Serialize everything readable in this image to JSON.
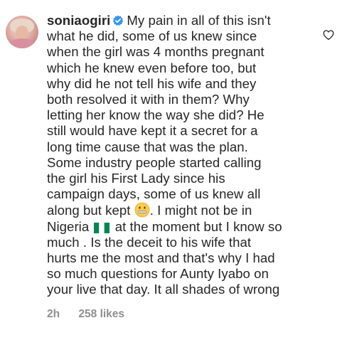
{
  "comment": {
    "username": "soniaogiri",
    "lines": [
      "My pain in all of this isn't",
      "what he did, some of us knew since",
      "when the girl was 4 months pregnant",
      "which he knew even before too, but",
      "why did he not tell his wife and they",
      "both resolved it with in them? Why",
      "letting her know the way she did? He",
      "still would have kept it a secret for a",
      "long time cause that was the plan.",
      "Some industry people started calling",
      "the girl his First Lady since his",
      "campaign days, some of us knew all"
    ],
    "line13_before_emoji": "along but kept ",
    "line13_after_emoji": ". I might not be in",
    "line14_before_flag": "Nigeria ",
    "line14_after_flag": " at the moment but I know so",
    "lines_after": [
      "much .  Is the deceit to his wife that",
      "hurts me the most and that's why I had",
      "so much questions for Aunty Iyabo on",
      "your live that day. It all shades of wrong"
    ],
    "emoji_name": "zipper-mouth-face",
    "flag_name": "nigeria-flag"
  },
  "meta": {
    "time": "2h",
    "likes": "258 likes"
  },
  "colors": {
    "text": "#262626",
    "meta": "#8e8e8e",
    "verified": "#3897f0",
    "flag_green": "#008751"
  },
  "icons": {
    "heart": "heart-outline-icon",
    "verified": "verified-badge-icon",
    "avatar": "profile-avatar"
  }
}
